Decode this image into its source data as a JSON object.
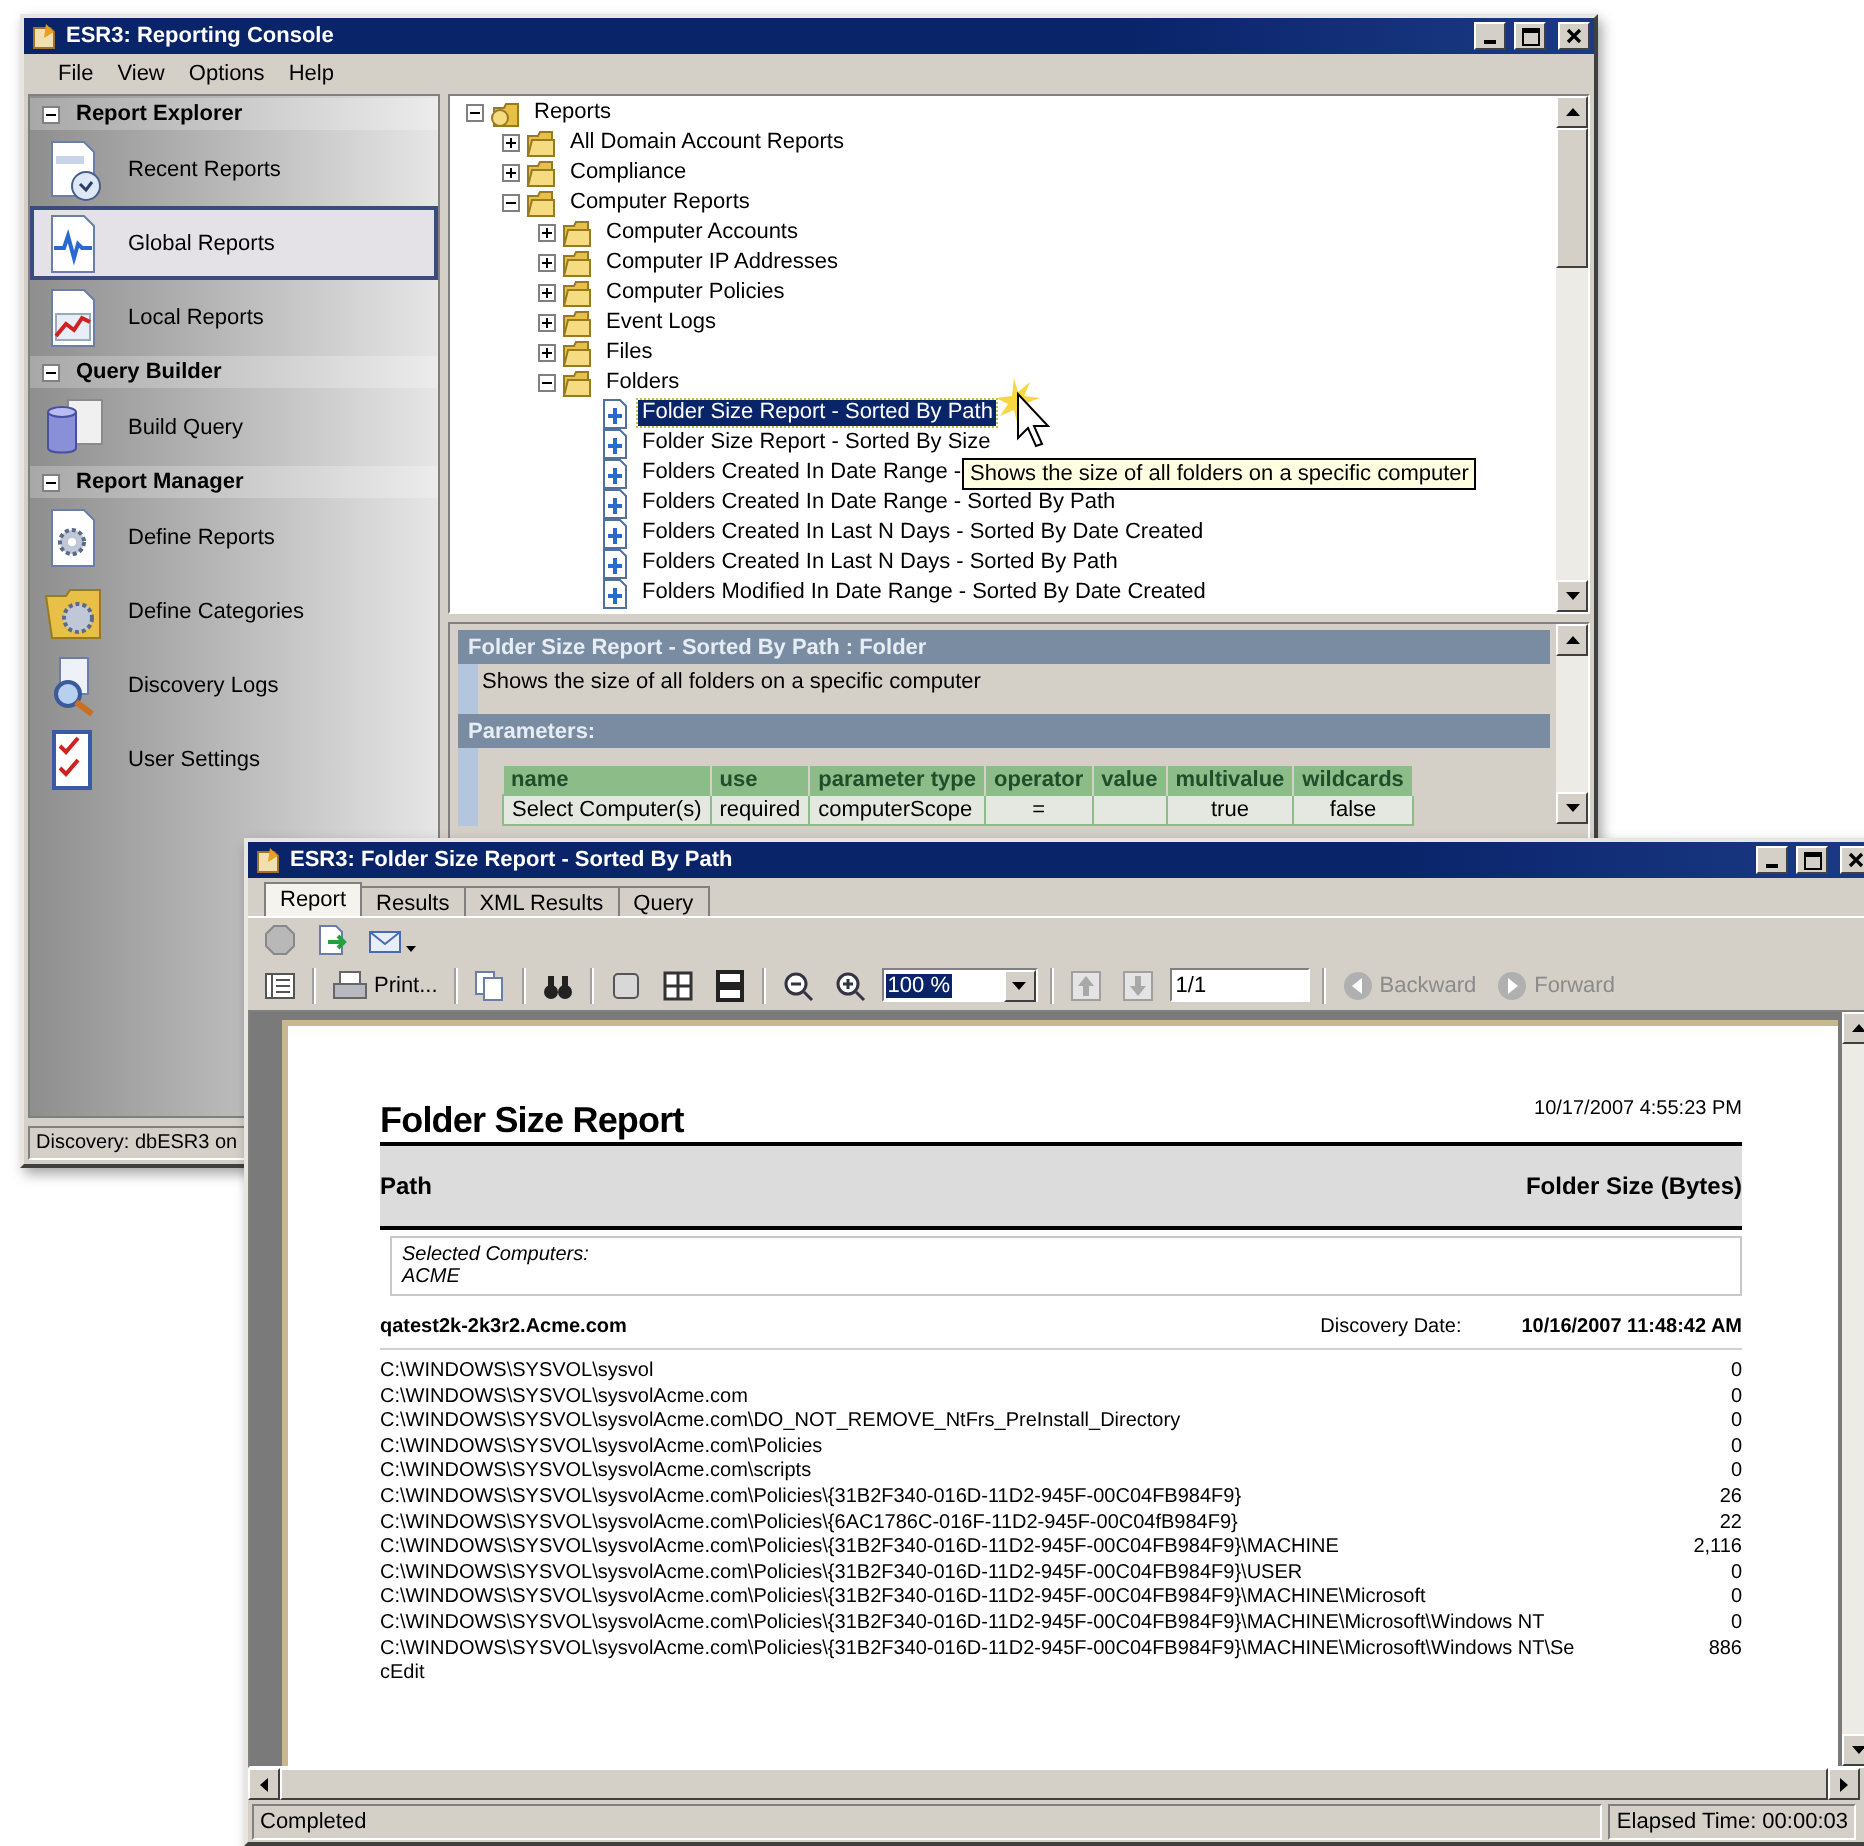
{
  "console": {
    "title": "ESR3: Reporting Console",
    "menu": [
      "File",
      "View",
      "Options",
      "Help"
    ],
    "sidebar": {
      "sections": [
        {
          "title": "Report Explorer",
          "items": [
            {
              "label": "Recent Reports",
              "kind": "recent",
              "selected": false
            },
            {
              "label": "Global Reports",
              "kind": "global",
              "selected": true
            },
            {
              "label": "Local Reports",
              "kind": "local",
              "selected": false
            }
          ]
        },
        {
          "title": "Query Builder",
          "items": [
            {
              "label": "Build Query",
              "kind": "query",
              "selected": false
            }
          ]
        },
        {
          "title": "Report Manager",
          "items": [
            {
              "label": "Define Reports",
              "kind": "define",
              "selected": false
            },
            {
              "label": "Define Categories",
              "kind": "categories",
              "selected": false
            },
            {
              "label": "Discovery Logs",
              "kind": "logs",
              "selected": false
            },
            {
              "label": "User Settings",
              "kind": "settings",
              "selected": false
            }
          ]
        }
      ]
    },
    "tree": [
      {
        "label": "Reports",
        "kind": "root",
        "expanded": true,
        "selected": false,
        "children": [
          {
            "label": "All Domain Account Reports",
            "kind": "folder",
            "expanded": false,
            "selected": false
          },
          {
            "label": "Compliance",
            "kind": "folder",
            "expanded": false,
            "selected": false
          },
          {
            "label": "Computer Reports",
            "kind": "folder",
            "expanded": true,
            "selected": false,
            "children": [
              {
                "label": "Computer Accounts",
                "kind": "folder",
                "expanded": false,
                "selected": false
              },
              {
                "label": "Computer IP Addresses",
                "kind": "folder",
                "expanded": false,
                "selected": false
              },
              {
                "label": "Computer Policies",
                "kind": "folder",
                "expanded": false,
                "selected": false
              },
              {
                "label": "Event Logs",
                "kind": "folder",
                "expanded": false,
                "selected": false
              },
              {
                "label": "Files",
                "kind": "folder",
                "expanded": false,
                "selected": false
              },
              {
                "label": "Folders",
                "kind": "folder",
                "expanded": true,
                "selected": false,
                "children": [
                  {
                    "label": "Folder Size Report - Sorted By Path",
                    "kind": "report",
                    "selected": true
                  },
                  {
                    "label": "Folder Size Report - Sorted By Size",
                    "kind": "report",
                    "selected": false
                  },
                  {
                    "label": "Folders Created In Date Range -",
                    "kind": "report",
                    "selected": false
                  },
                  {
                    "label": "Folders Created In Date Range - Sorted By Path",
                    "kind": "report",
                    "selected": false
                  },
                  {
                    "label": "Folders Created In Last N Days - Sorted By Date Created",
                    "kind": "report",
                    "selected": false
                  },
                  {
                    "label": "Folders Created In Last N Days - Sorted By Path",
                    "kind": "report",
                    "selected": false
                  },
                  {
                    "label": "Folders Modified In Date Range - Sorted By Date Created",
                    "kind": "report",
                    "selected": false
                  }
                ]
              }
            ]
          }
        ]
      }
    ],
    "tooltip": "Shows the size of all folders on a specific computer",
    "details": {
      "heading": "Folder Size Report - Sorted By Path : Folder",
      "description": "Shows the size of all folders on a specific computer",
      "parameters_heading": "Parameters:",
      "columns": [
        "name",
        "use",
        "parameter type",
        "operator",
        "value",
        "multivalue",
        "wildcards"
      ],
      "rows": [
        [
          "Select Computer(s)",
          "required",
          "computerScope",
          "=",
          "",
          "true",
          "false"
        ]
      ]
    },
    "status": "Discovery: dbESR3 on"
  },
  "report_window": {
    "title": "ESR3: Folder Size Report - Sorted By Path",
    "tabs": [
      {
        "label": "Report",
        "selected": true
      },
      {
        "label": "Results",
        "selected": false
      },
      {
        "label": "XML Results",
        "selected": false
      },
      {
        "label": "Query",
        "selected": false
      }
    ],
    "print": "Print...",
    "zoom": "100 %",
    "page": "1/1",
    "backward": {
      "label": "Backward",
      "disabled": true
    },
    "forward": {
      "label": "Forward",
      "disabled": true
    },
    "report": {
      "title": "Folder Size Report",
      "timestamp": "10/17/2007 4:55:23 PM",
      "path_heading": "Path",
      "size_heading": "Folder Size (Bytes)",
      "selected_label": "Selected Computers:",
      "selected_value": "ACME",
      "host": "qatest2k-2k3r2.Acme.com",
      "discovery_label": "Discovery Date:",
      "discovery_date": "10/16/2007 11:48:42 AM",
      "rows": [
        {
          "path": "C:\\WINDOWS\\SYSVOL\\sysvol",
          "size": "0"
        },
        {
          "path": "C:\\WINDOWS\\SYSVOL\\sysvolAcme.com",
          "size": "0"
        },
        {
          "path": "C:\\WINDOWS\\SYSVOL\\sysvolAcme.com\\DO_NOT_REMOVE_NtFrs_PreInstall_Directory",
          "size": "0"
        },
        {
          "path": "C:\\WINDOWS\\SYSVOL\\sysvolAcme.com\\Policies",
          "size": "0"
        },
        {
          "path": "C:\\WINDOWS\\SYSVOL\\sysvolAcme.com\\scripts",
          "size": "0"
        },
        {
          "path": "C:\\WINDOWS\\SYSVOL\\sysvolAcme.com\\Policies\\{31B2F340-016D-11D2-945F-00C04FB984F9}",
          "size": "26"
        },
        {
          "path": "C:\\WINDOWS\\SYSVOL\\sysvolAcme.com\\Policies\\{6AC1786C-016F-11D2-945F-00C04fB984F9}",
          "size": "22"
        },
        {
          "path": "C:\\WINDOWS\\SYSVOL\\sysvolAcme.com\\Policies\\{31B2F340-016D-11D2-945F-00C04FB984F9}\\MACHINE",
          "size": "2,116"
        },
        {
          "path": "C:\\WINDOWS\\SYSVOL\\sysvolAcme.com\\Policies\\{31B2F340-016D-11D2-945F-00C04FB984F9}\\USER",
          "size": "0"
        },
        {
          "path": "C:\\WINDOWS\\SYSVOL\\sysvolAcme.com\\Policies\\{31B2F340-016D-11D2-945F-00C04FB984F9}\\MACHINE\\Microsoft",
          "size": "0"
        },
        {
          "path": "C:\\WINDOWS\\SYSVOL\\sysvolAcme.com\\Policies\\{31B2F340-016D-11D2-945F-00C04FB984F9}\\MACHINE\\Microsoft\\Windows NT",
          "size": "0"
        },
        {
          "path": "C:\\WINDOWS\\SYSVOL\\sysvolAcme.com\\Policies\\{31B2F340-016D-11D2-945F-00C04FB984F9}\\MACHINE\\Microsoft\\Windows NT\\SecEdit",
          "size": "886"
        }
      ]
    },
    "status": "Completed",
    "elapsed": "Elapsed Time: 00:00:03"
  }
}
